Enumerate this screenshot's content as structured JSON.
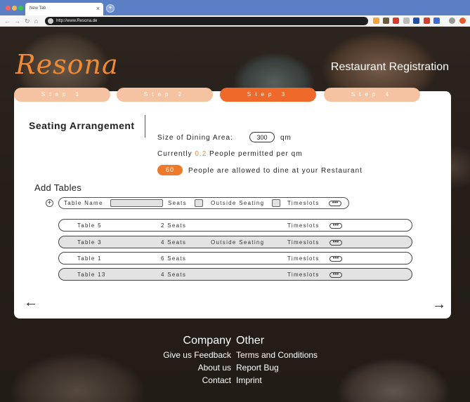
{
  "browser": {
    "tab_title": "New Tab",
    "tab_close": "×",
    "new_tab": "+",
    "url": "http://www.Resona.de",
    "extension_colors": [
      "#f2a33a",
      "#6b5a3a",
      "#d9382c",
      "#bbbbbb",
      "#1f4fa3",
      "#d93a2c",
      "#3b6bd6"
    ]
  },
  "header": {
    "logo": "Resona",
    "title": "Restaurant Registration"
  },
  "steps": [
    {
      "label": "Step 1",
      "active": false
    },
    {
      "label": "Step 2",
      "active": false
    },
    {
      "label": "Step 3",
      "active": true
    },
    {
      "label": "Step 4",
      "active": false
    }
  ],
  "seating": {
    "title": "Seating Arrangement",
    "area_label": "Size of Dining Area:",
    "area_value": "300",
    "area_unit": "qm",
    "permitted_prefix": "Currently",
    "permitted_value": "0.2",
    "permitted_suffix": "People permitted per qm",
    "people_count": "60",
    "people_text": "People are allowed to dine at your Restaurant"
  },
  "add_tables": {
    "title": "Add Tables",
    "table_name_label": "Table Name",
    "seats_label": "Seats",
    "outside_label": "Outside Seating",
    "timeslots_label": "Timeslots"
  },
  "tables": [
    {
      "name": "Table 5",
      "seats": "2 Seats",
      "outside": "",
      "timeslots": "Timeslots"
    },
    {
      "name": "Table 3",
      "seats": "4 Seats",
      "outside": "Outside Seating",
      "timeslots": "Timeslots"
    },
    {
      "name": "Table 1",
      "seats": "6 Seats",
      "outside": "",
      "timeslots": "Timeslots"
    },
    {
      "name": "Table 13",
      "seats": "4 Seats",
      "outside": "",
      "timeslots": "Timeslots"
    }
  ],
  "nav": {
    "back": "←",
    "next": "→"
  },
  "footer": {
    "company_heading": "Company",
    "other_heading": "Other",
    "company_links": [
      "Give us Feedback",
      "About us",
      "Contact"
    ],
    "other_links": [
      "Terms and Conditions",
      "Report Bug",
      "Imprint"
    ]
  }
}
